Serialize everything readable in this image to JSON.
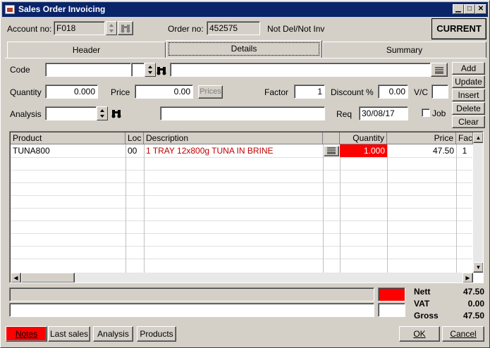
{
  "window": {
    "title": "Sales Order Invoicing"
  },
  "header": {
    "account_label": "Account no:",
    "account_value": "F018",
    "order_label": "Order no:",
    "order_value": "452575",
    "status_text": "Not Del/Not Inv",
    "current_button": "CURRENT"
  },
  "tabs": [
    {
      "label": "Header"
    },
    {
      "label": "Details"
    },
    {
      "label": "Summary"
    }
  ],
  "details": {
    "code_label": "Code",
    "code_value": "",
    "code_desc": "",
    "quantity_label": "Quantity",
    "quantity_value": "0.000",
    "price_label": "Price",
    "price_value": "0.00",
    "prices_button": "Prices",
    "factor_label": "Factor",
    "factor_value": "1",
    "discount_label": "Discount %",
    "discount_value": "0.00",
    "vc_label": "V/C",
    "vc_value": "",
    "analysis_label": "Analysis",
    "analysis_value": "",
    "analysis_desc": "",
    "req_label": "Req",
    "req_value": "30/08/17",
    "job_label": "Job"
  },
  "side_buttons": {
    "add": "Add",
    "update": "Update",
    "insert": "Insert",
    "delete": "Delete",
    "clear": "Clear"
  },
  "grid": {
    "columns": [
      "Product",
      "Loc",
      "Description",
      "",
      "Quantity",
      "Price",
      "Fact"
    ],
    "rows": [
      {
        "product": "TUNA800",
        "loc": "00",
        "description": "1 TRAY 12x800g TUNA IN BRINE",
        "quantity": "1.000",
        "price": "47.50",
        "factor": "1"
      }
    ]
  },
  "totals": {
    "nett_label": "Nett",
    "nett_value": "47.50",
    "vat_label": "VAT",
    "vat_value": "0.00",
    "gross_label": "Gross",
    "gross_value": "47.50"
  },
  "footer": {
    "notes": "Notes",
    "last_sales": "Last sales",
    "analysis": "Analysis",
    "products": "Products",
    "ok": "OK",
    "cancel": "Cancel"
  },
  "colors": {
    "title_bar": "#0a246a",
    "highlight_red": "#ff0000",
    "desc_red": "#c00000",
    "face": "#d4d0c8"
  }
}
